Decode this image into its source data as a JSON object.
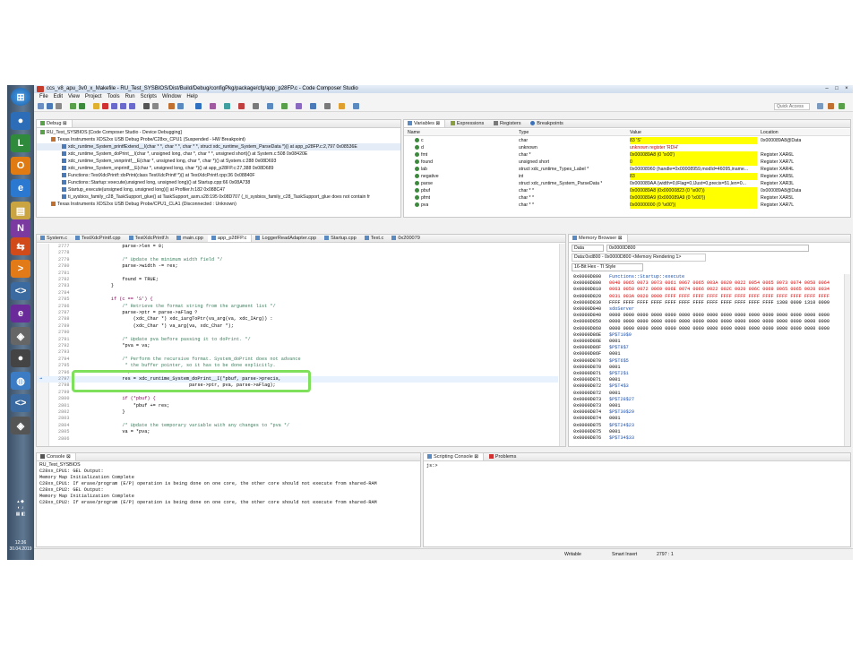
{
  "window": {
    "title": "ccs_v8_apu_3v0_x_Makefile - RU_Test_SYSBIOS/Dist/Build/Debug/configPkg/package/cfg/app_p28FP.c - Code Composer Studio",
    "minimize": "‒",
    "maximize": "□",
    "close": "×"
  },
  "menu": [
    "File",
    "Edit",
    "View",
    "Project",
    "Tools",
    "Run",
    "Scripts",
    "Window",
    "Help"
  ],
  "toolbar": {
    "quick_access": "Quick Access"
  },
  "debug": {
    "tab": "Debug",
    "rows": [
      {
        "text": "RU_Test_SYSBIOS [Code Composer Studio - Device Debugging]",
        "indent": 0
      },
      {
        "text": "Texas Instruments XDS2xx USB Debug Probe/C28xx_CPU1 (Suspended - HW Breakpoint)",
        "indent": 1
      },
      {
        "text": "xdc_runtime_System_printfExtend__I(char * *, char * *, char * *, struct xdc_runtime_System_ParseData *)() at app_p28FP.c:2,797 0x08536E",
        "indent": 2,
        "selected": true
      },
      {
        "text": "xdc_runtime_System_doPrint__I(char *, unsigned long, char *, char * *, unsigned short)() at System.c:508 0x08420E",
        "indent": 2
      },
      {
        "text": "xdc_runtime_System_vsnprintf__E(char *, unsigned long, char *, char *)() at System.c:288 0x08D693",
        "indent": 2
      },
      {
        "text": "xdc_runtime_System_snprintf__E(char *, unsigned long, char *)() at app_p28FP.c:27,388 0x08D689",
        "indent": 2
      },
      {
        "text": "Functions::TestXdcPrintf::doPrint(class TestXdcPrintf *)() at TestXdcPrintf.cpp:36 0x08840F",
        "indent": 2
      },
      {
        "text": "Functions::Startup::execute(unsigned long, unsigned long)() at Startup.cpp:66 0x08A738",
        "indent": 2
      },
      {
        "text": "Startup_execute(unsigned long, unsigned long)() at Profiler.h:182 0x088C47",
        "indent": 2
      },
      {
        "text": "ti_sysbios_family_c28_TaskSupport_glue() at TaskSupport_asm.s28:195 0x08D707  (_ti_sysbios_family_c28_TaskSupport_glue does not contain fr",
        "indent": 2
      },
      {
        "text": "Texas Instruments XDS2xx USB Debug Probe/CPU1_CLA1 (Disconnected : Unknown)",
        "indent": 1
      }
    ]
  },
  "variables": {
    "tabs": [
      "Variables",
      "Expressions",
      "Registers",
      "Breakpoints"
    ],
    "headers": [
      "Name",
      "Type",
      "Value",
      "Location"
    ],
    "rows": [
      {
        "name": "c",
        "type": "char",
        "value": "83 'S'",
        "location": "0x000089A8@Data",
        "hl": true
      },
      {
        "name": "d",
        "type": "unknown",
        "value": "unknown register 'RDH'",
        "location": "",
        "red": true
      },
      {
        "name": "fmt",
        "type": "char *",
        "value": "0x000089A8 (0 '\\x00')",
        "location": "Register XAR6L",
        "hl": true
      },
      {
        "name": "found",
        "type": "unsigned short",
        "value": "0",
        "location": "Register XAR7L",
        "hl": true
      },
      {
        "name": "lab",
        "type": "struct xdc_runtime_Types_Label *",
        "value": "0x00008960 {handle=0x00008959,modId=46095,iname...",
        "location": "Register XAR4L",
        "hl": false
      },
      {
        "name": "negative",
        "type": "int",
        "value": "83",
        "location": "Register XAR5L",
        "hl": true
      },
      {
        "name": "parse",
        "type": "struct xdc_runtime_System_ParseData *",
        "value": "0x000089AA {width=0,lFlag=0,lJust=0,precis=51,len=0...",
        "location": "Register XAR3L",
        "hl": false
      },
      {
        "name": "pbuf",
        "type": "char * *",
        "value": "0x000089A8 (0x00000823 (0 '\\x00'))",
        "location": "0x000089A8@Data",
        "hl": true
      },
      {
        "name": "pfmt",
        "type": "char * *",
        "value": "0x000089A9 (0x000089A9 (0 '\\x00'))",
        "location": "Register XAR5L",
        "hl": true
      },
      {
        "name": "pva",
        "type": "char * *",
        "value": "0x00000000 (0 '\\x00'))",
        "location": "Register XAR7L",
        "hl": true
      }
    ]
  },
  "editor": {
    "tabs": [
      "System.c",
      "TestXdcPrintf.cpp",
      "TestXdcPrintf.h",
      "main.cpp",
      "app_p28FP.c",
      "LoggerReadAdapter.cpp",
      "Startup.cpp",
      "Text.c",
      "0x200079"
    ],
    "active_tab": "app_p28FP.c",
    "lines": [
      {
        "n": "2777",
        "t": "            parse->len = 0;",
        "k": ""
      },
      {
        "n": "2778",
        "t": "",
        "k": ""
      },
      {
        "n": "2779",
        "t": "            /* Update the minimum width field */",
        "k": "c"
      },
      {
        "n": "2780",
        "t": "            parse->width -= res;",
        "k": ""
      },
      {
        "n": "2781",
        "t": "",
        "k": ""
      },
      {
        "n": "2782",
        "t": "            found = TRUE;",
        "k": ""
      },
      {
        "n": "2783",
        "t": "        }",
        "k": ""
      },
      {
        "n": "2784",
        "t": "",
        "k": ""
      },
      {
        "n": "2785",
        "t": "        if (c == 'S') {",
        "k": "k"
      },
      {
        "n": "2786",
        "t": "            /* Retrieve the format string from the argument list */",
        "k": "c"
      },
      {
        "n": "2787",
        "t": "            parse->ptr = parse->aFlag ?",
        "k": ""
      },
      {
        "n": "2788",
        "t": "                (xdc_Char *) xdc_iargToPtr(va_arg(va, xdc_IArg)) :",
        "k": ""
      },
      {
        "n": "2789",
        "t": "                (xdc_Char *) va_arg(va, xdc_Char *);",
        "k": ""
      },
      {
        "n": "2790",
        "t": "",
        "k": ""
      },
      {
        "n": "2791",
        "t": "            /* Update pva before passing it to doPrint. */",
        "k": "c"
      },
      {
        "n": "2792",
        "t": "            *pva = va;",
        "k": ""
      },
      {
        "n": "2793",
        "t": "",
        "k": ""
      },
      {
        "n": "2794",
        "t": "            /* Perform the recursive format. System_doPrint does not advance",
        "k": "c"
      },
      {
        "n": "2795",
        "t": "             * the buffer pointer, so it has to be done explicitly.",
        "k": "c"
      },
      {
        "n": "2796",
        "t": "             */",
        "k": "c"
      },
      {
        "n": "2797",
        "t": "            res = xdc_runtime_System_doPrint__I(*pbuf, parse->precis,",
        "k": "",
        "cur": true
      },
      {
        "n": "2798",
        "t": "                                    parse->ptr, pva, parse->aFlag);",
        "k": ""
      },
      {
        "n": "2799",
        "t": "",
        "k": ""
      },
      {
        "n": "2800",
        "t": "            if (*pbuf) {",
        "k": "k"
      },
      {
        "n": "2801",
        "t": "                *pbuf += res;",
        "k": ""
      },
      {
        "n": "2802",
        "t": "            }",
        "k": ""
      },
      {
        "n": "2803",
        "t": "",
        "k": ""
      },
      {
        "n": "2804",
        "t": "            /* Update the temporary variable with any changes to *pva */",
        "k": "c"
      },
      {
        "n": "2805",
        "t": "            va = *pva;",
        "k": ""
      },
      {
        "n": "2806",
        "t": "",
        "k": ""
      }
    ]
  },
  "memory": {
    "tab": "Memory Browser",
    "address_value": "0x0000D800",
    "space": "Data",
    "rendering_tab": "Data:0xd800 - 0x0000D800 <Memory Rendering 1>",
    "format": "16-Bit Hex - TI Style",
    "rows": [
      {
        "a": "0x0000D800",
        "v": "Functions::Startup::execute",
        "c": "blue"
      },
      {
        "a": "0x0000D800",
        "v": "0040 0065 0073 0073 0061 0067 0065 003A 0020 0022 0054 0065 0073 0074 0050 0064",
        "c": "red"
      },
      {
        "a": "0x0000D810",
        "v": "0063 0050 0072 0069 006E 0074 0066 0022 002C 0020 006C 0069 0065 0065 0020 0034",
        "c": "red"
      },
      {
        "a": "0x0000D820",
        "v": "0031 003A 0020 0000 FFFF FFFF FFFF FFFF FFFF FFFF FFFF FFFF FFFF FFFF FFFF FFFF",
        "c": "red"
      },
      {
        "a": "0x0000D830",
        "v": "FFFF FFFF FFFF FFFF FFFF FFFF FFFF FFFF FFFF FFFF FFFF FFFF 1308 0009 1310 0009",
        "c": ""
      },
      {
        "a": "0x0000D840",
        "v": "sdoServer",
        "c": "blue"
      },
      {
        "a": "0x0000D840",
        "v": "0000 0000 0000 0000 0000 0000 0000 0000 0000 0000 0000 0000 0000 0000 0000 0000",
        "c": ""
      },
      {
        "a": "0x0000D850",
        "v": "0000 0000 0000 0000 0000 0000 0000 0000 0000 0000 0000 0000 0000 0000 0000 0000",
        "c": ""
      },
      {
        "a": "0x0000D860",
        "v": "0000 0000 0000 0000 0000 0000 0000 0000 0000 0000 0000 0000 0000 0000 0000 0000",
        "c": ""
      },
      {
        "a": "0x0000D86E",
        "v": "$P$T10$9",
        "c": "blue"
      },
      {
        "a": "0x0000D86E",
        "v": "0001",
        "c": ""
      },
      {
        "a": "0x0000D86F",
        "v": "$P$T8$7",
        "c": "blue"
      },
      {
        "a": "0x0000D86F",
        "v": "0001",
        "c": ""
      },
      {
        "a": "0x0000D870",
        "v": "$P$T6$5",
        "c": "blue"
      },
      {
        "a": "0x0000D870",
        "v": "0001",
        "c": ""
      },
      {
        "a": "0x0000D871",
        "v": "$P$T2$1",
        "c": "blue"
      },
      {
        "a": "0x0000D871",
        "v": "0001",
        "c": ""
      },
      {
        "a": "0x0000D872",
        "v": "$P$T4$3",
        "c": "blue"
      },
      {
        "a": "0x0000D872",
        "v": "0001",
        "c": ""
      },
      {
        "a": "0x0000D873",
        "v": "$P$T28$27",
        "c": "blue"
      },
      {
        "a": "0x0000D873",
        "v": "0001",
        "c": ""
      },
      {
        "a": "0x0000D874",
        "v": "$P$T30$29",
        "c": "blue"
      },
      {
        "a": "0x0000D874",
        "v": "0001",
        "c": ""
      },
      {
        "a": "0x0000D875",
        "v": "$P$T24$23",
        "c": "blue"
      },
      {
        "a": "0x0000D875",
        "v": "0001",
        "c": ""
      },
      {
        "a": "0x0000D876",
        "v": "$P$T34$33",
        "c": "blue"
      }
    ]
  },
  "console": {
    "tab": "Console",
    "subtitle": "RU_Test_SYSBIOS",
    "lines": [
      "C28xx_CPU1: GEL Output:",
      "Memory Map Initialization Complete",
      "C28xx_CPU1: If erase/program (E/P) operation is being done on one core, the other core should not execute from shared-RAM",
      "C28xx_CPU2: GEL Output:",
      "Memory Map Initialization Complete",
      "C28xx_CPU2: If erase/program (E/P) operation is being done on one core, the other core should not execute from shared-RAM"
    ]
  },
  "scripting": {
    "tabs": [
      "Scripting Console",
      "Problems"
    ],
    "prompt": "js:>"
  },
  "status": {
    "writable": "Writable",
    "insert": "Smart Insert",
    "position": "2797 : 1"
  },
  "clock": {
    "time": "12:36",
    "date": "30.04.2019"
  },
  "colors": {
    "highlight_yellow": "#ffff00",
    "annotation_green": "#7ee05b",
    "error_red": "#d00000"
  }
}
